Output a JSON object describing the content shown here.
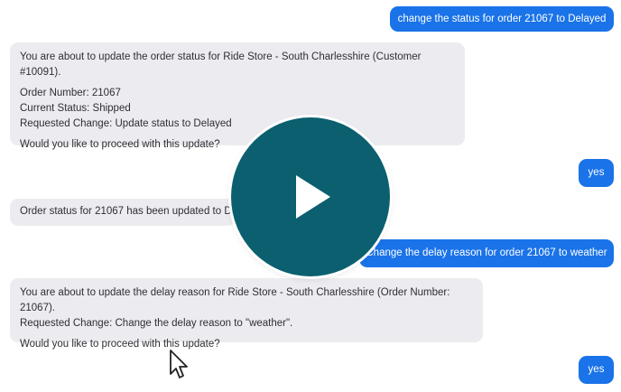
{
  "messages": [
    {
      "role": "user",
      "text": "change the status for order 21067 to Delayed"
    },
    {
      "role": "assistant",
      "lines": [
        "You are about to update the order status for Ride Store - South Charlesshire (Customer #10091).",
        "Order Number: 21067",
        "Current Status: Shipped",
        "Requested Change: Update status to Delayed",
        "Would you like to proceed with this update?"
      ]
    },
    {
      "role": "user",
      "text": "yes"
    },
    {
      "role": "assistant",
      "text": "Order status for 21067 has been updated to De"
    },
    {
      "role": "user",
      "text": "Change the delay reason for order 21067 to weather"
    },
    {
      "role": "assistant",
      "lines": [
        "You are about to update the delay reason for Ride Store - South Charlesshire (Order Number: 21067).",
        "Requested Change: Change the delay reason to \"weather\".",
        "Would you like to proceed with this update?"
      ]
    },
    {
      "role": "user",
      "text": "yes"
    }
  ],
  "overlay": {
    "icon": "play-icon",
    "color": "#0b5f6f"
  },
  "colors": {
    "user_bubble": "#1a73e8",
    "assistant_bubble": "#ececf0"
  }
}
